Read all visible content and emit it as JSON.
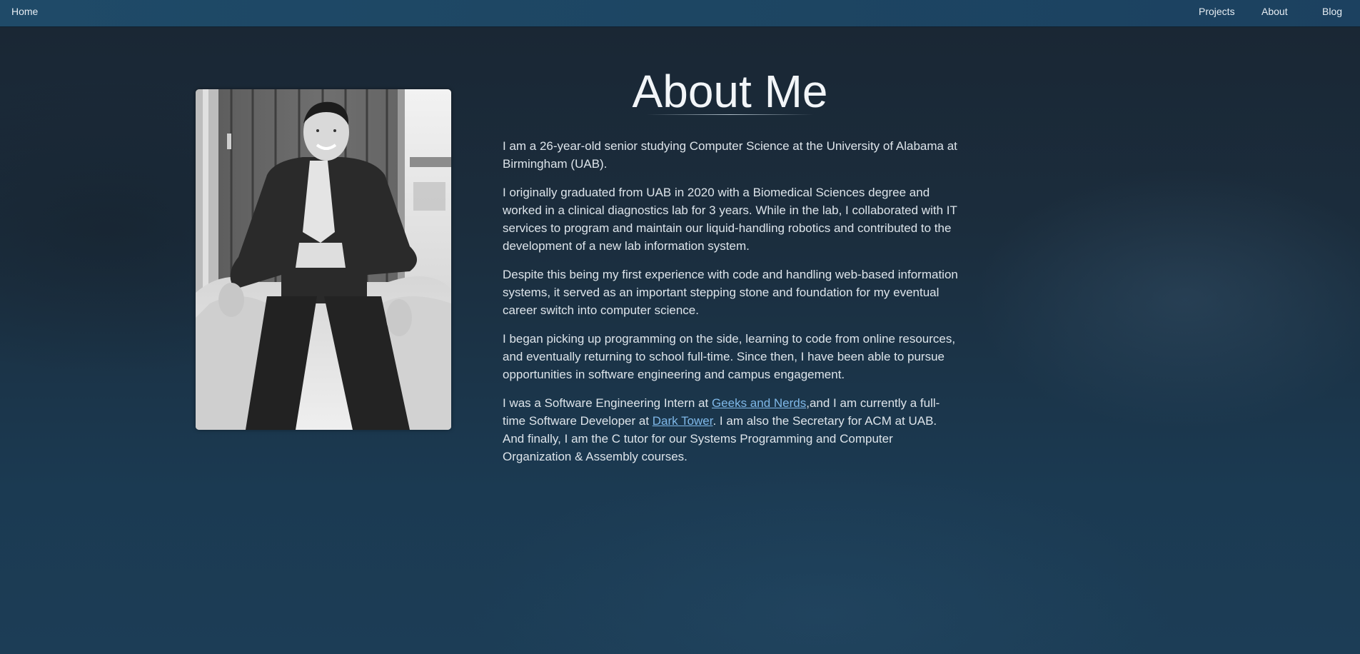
{
  "nav": {
    "home": "Home",
    "projects": "Projects",
    "about": "About",
    "blog": "Blog"
  },
  "page": {
    "title": "About Me"
  },
  "paragraphs": {
    "p1": "I am a 26-year-old senior studying Computer Science at the University of Alabama at Birmingham (UAB).",
    "p2": "I originally graduated from UAB in 2020 with a Biomedical Sciences degree and worked in a clinical diagnostics lab for 3 years. While in the lab, I collaborated with IT services to program and maintain our liquid-handling robotics and contributed to the development of a new lab information system.",
    "p3": "Despite this being my first experience with code and handling web-based information systems, it served as an important stepping stone and foundation for my eventual career switch into computer science.",
    "p4": "I began picking up programming on the side, learning to code from online resources, and eventually returning to school full-time. Since then, I have been able to pursue opportunities in software engineering and campus engagement.",
    "p5_part1": "I was a Software Engineering Intern at ",
    "p5_link1": "Geeks and Nerds",
    "p5_part2": ",and I am currently a full-time Software Developer at ",
    "p5_link2": "Dark Tower",
    "p5_part3": ". I am also the Secretary for ACM at UAB. And finally, I am the C tutor for our Systems Programming and Computer Organization & Assembly courses."
  },
  "colors": {
    "navbar": "#1f4a68",
    "background": "#1b2d3d",
    "text": "#dde4ea",
    "link": "#7fb8e8"
  }
}
